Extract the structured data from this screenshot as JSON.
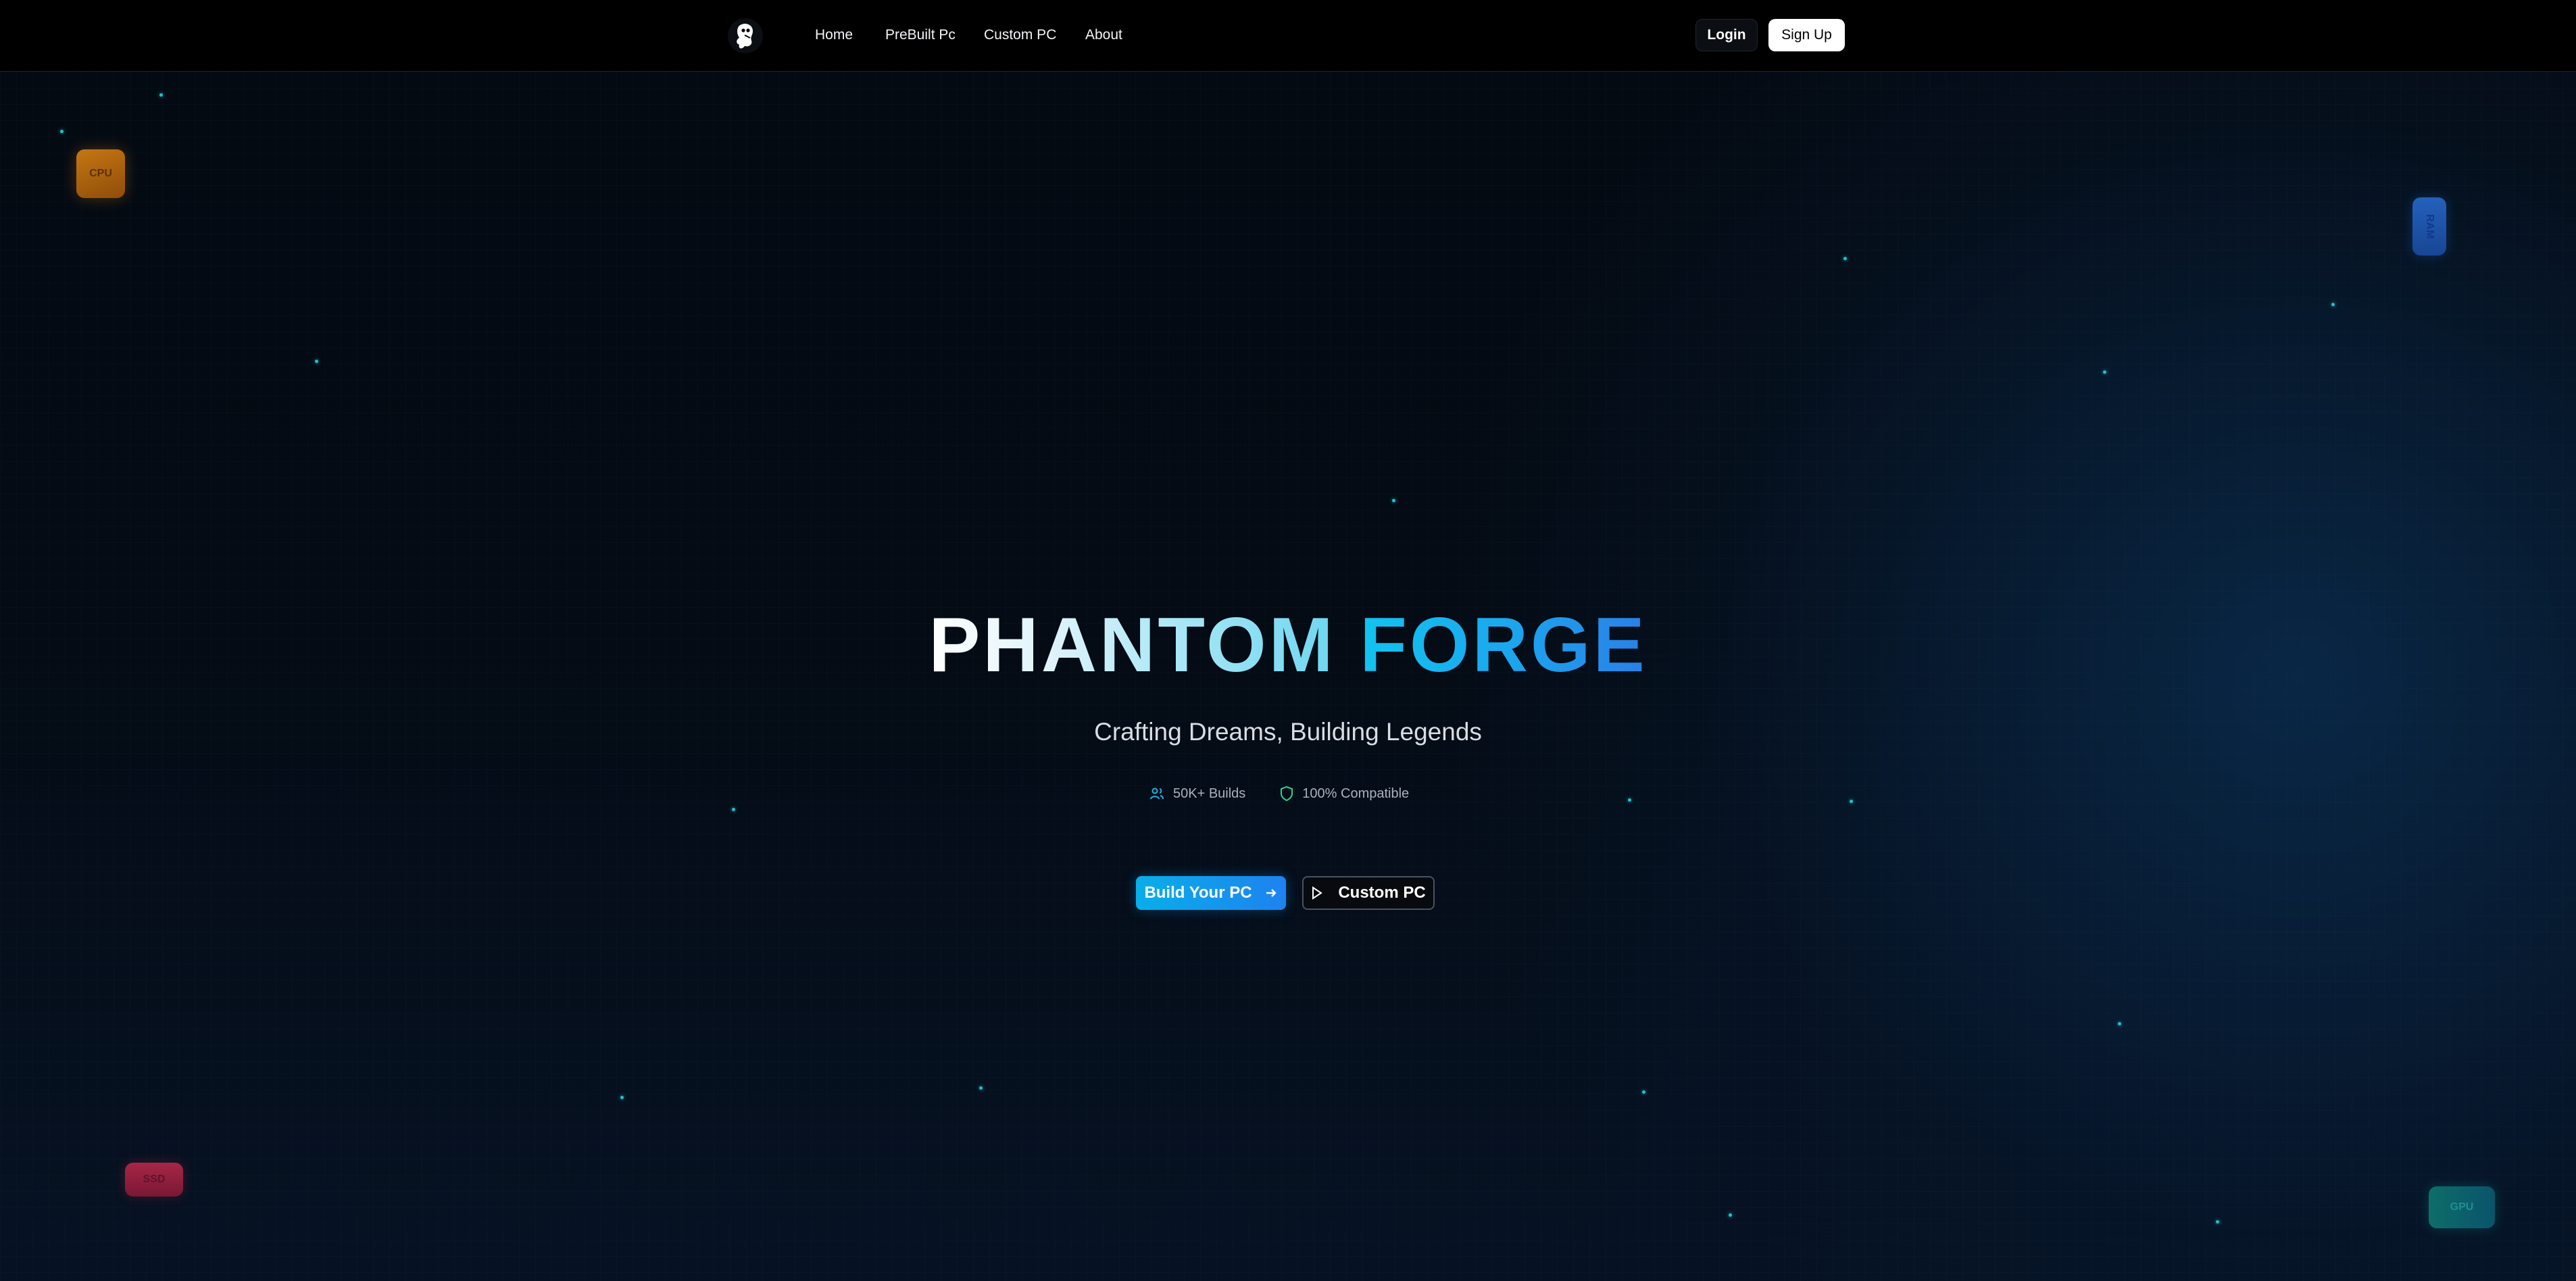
{
  "navbar": {
    "logo_icon": "ghost-logo-icon",
    "links": [
      {
        "label": "Home"
      },
      {
        "label": "PreBuilt Pc"
      },
      {
        "label": "Custom PC"
      },
      {
        "label": "About"
      }
    ],
    "login_label": "Login",
    "signup_label": "Sign Up"
  },
  "hero": {
    "title_part1": "PHANTOM",
    "title_part2": "FORGE",
    "subtitle": "Crafting Dreams, Building Legends",
    "stats": [
      {
        "icon": "users-icon",
        "label": "50K+ Builds"
      },
      {
        "icon": "shield-icon",
        "label": "100% Compatible"
      }
    ],
    "primary_button": "Build Your PC",
    "secondary_button": "Custom PC"
  },
  "floating_chips": {
    "cpu": "CPU",
    "ram": "RAM",
    "ssd": "SSD",
    "gpu": "GPU"
  },
  "colors": {
    "accent_cyan": "#08aee9",
    "accent_blue": "#1e82f0",
    "cpu_chip": "#e88a12",
    "ram_chip": "#2a6fd8",
    "ssd_chip": "#c42a4e",
    "gpu_chip": "#0f7d74",
    "particle": "#23c0c8"
  }
}
